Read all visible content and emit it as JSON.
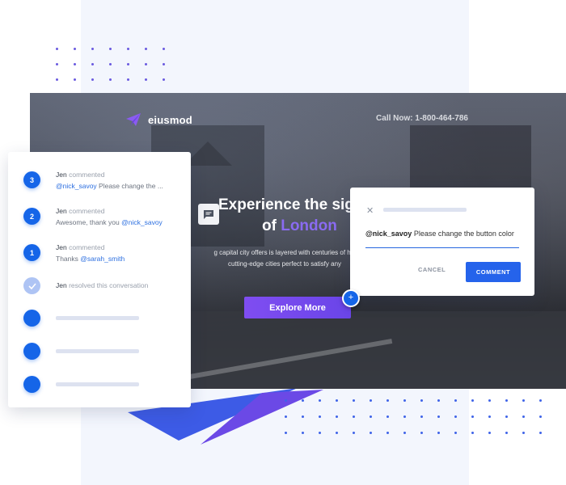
{
  "brand": {
    "name": "eiusmod",
    "logo_icon": "paper-plane-icon",
    "accent": "#7f4df1"
  },
  "header": {
    "call_now": "Call Now: 1-800-464-786"
  },
  "hero": {
    "title_part1": "Experience the sig",
    "title_part2": "of ",
    "title_accent": "London",
    "description_line1": "g capital city offers is layered with centuries of his",
    "description_line2": "cutting-edge cities perfect to satisfy any",
    "cta_label": "Explore More",
    "comment_icon": "chat-bubble-icon"
  },
  "thread": {
    "items": [
      {
        "badge": "3",
        "author": "Jen",
        "verb": "commented",
        "mention": "@nick_savoy",
        "message": " Please change the ...",
        "mention_first": true
      },
      {
        "badge": "2",
        "author": "Jen",
        "verb": "commented",
        "message": "Awesome, thank you ",
        "mention": "@nick_savoy",
        "mention_first": false
      },
      {
        "badge": "1",
        "author": "Jen",
        "verb": "commented",
        "message": "Thanks ",
        "mention": "@sarah_smith",
        "mention_first": false
      },
      {
        "badge_icon": "check-icon",
        "author": "Jen",
        "verb": "resolved this conversation"
      }
    ]
  },
  "dialog": {
    "close_icon": "close-icon",
    "input_mention": "@nick_savoy",
    "input_text": " Please change the button color",
    "cancel_label": "CANCEL",
    "comment_label": "COMMENT",
    "add_icon": "plus-icon",
    "add_label": "+"
  },
  "colors": {
    "primary": "#1565e8",
    "accent_purple": "#8a6bf2",
    "panel_bg": "#f3f6fd"
  }
}
